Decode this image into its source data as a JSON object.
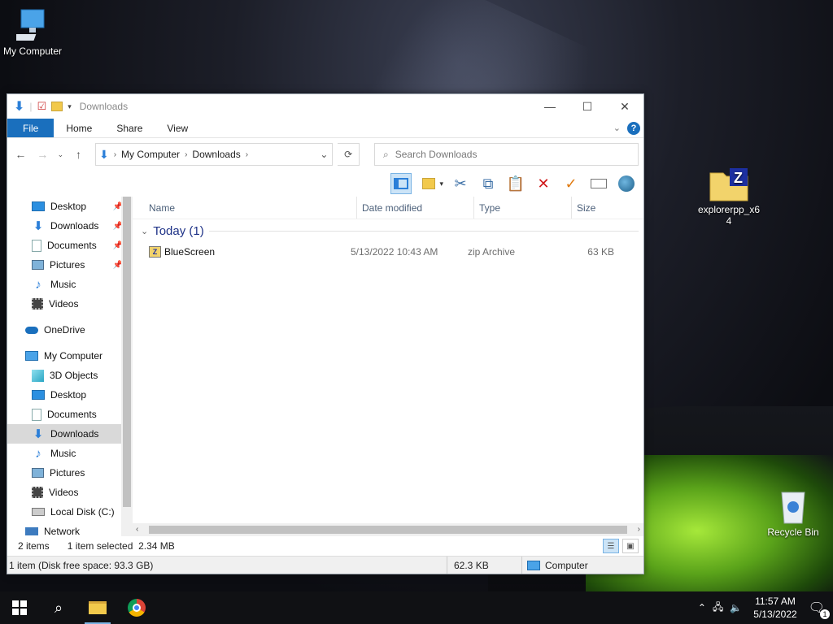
{
  "desktop": {
    "icons": [
      {
        "label": "My Computer"
      },
      {
        "label": "explorerpp_x64"
      },
      {
        "label": "Recycle Bin"
      }
    ]
  },
  "window": {
    "title": "Downloads",
    "ribbon_tabs": [
      "File",
      "Home",
      "Share",
      "View"
    ],
    "address": {
      "segments": [
        "My Computer",
        "Downloads"
      ]
    },
    "search": {
      "placeholder": "Search Downloads"
    },
    "nav": {
      "quick_access": [
        {
          "label": "Desktop",
          "icon": "desktop-icon",
          "pinned": true
        },
        {
          "label": "Downloads",
          "icon": "download-icon",
          "pinned": true
        },
        {
          "label": "Documents",
          "icon": "document-icon",
          "pinned": true
        },
        {
          "label": "Pictures",
          "icon": "picture-icon",
          "pinned": true
        },
        {
          "label": "Music",
          "icon": "music-icon",
          "pinned": false
        },
        {
          "label": "Videos",
          "icon": "video-icon",
          "pinned": false
        }
      ],
      "onedrive": "OneDrive",
      "computer": "My Computer",
      "computer_items": [
        {
          "label": "3D Objects",
          "icon": "cube-icon"
        },
        {
          "label": "Desktop",
          "icon": "desktop-icon"
        },
        {
          "label": "Documents",
          "icon": "document-icon"
        },
        {
          "label": "Downloads",
          "icon": "download-icon",
          "selected": true
        },
        {
          "label": "Music",
          "icon": "music-icon"
        },
        {
          "label": "Pictures",
          "icon": "picture-icon"
        },
        {
          "label": "Videos",
          "icon": "video-icon"
        },
        {
          "label": "Local Disk (C:)",
          "icon": "drive-icon"
        }
      ],
      "network": "Network"
    },
    "columns": {
      "name": "Name",
      "date": "Date modified",
      "type": "Type",
      "size": "Size"
    },
    "group": "Today (1)",
    "files": [
      {
        "name": "BlueScreen",
        "date": "5/13/2022 10:43 AM",
        "type": "zip Archive",
        "size": "63 KB"
      }
    ],
    "status": {
      "items": "2 items",
      "selected": "1 item selected  2.34 MB",
      "free_space": "1 item (Disk free space: 93.3 GB)",
      "size": "62.3 KB",
      "location": "Computer"
    }
  },
  "taskbar": {
    "time": "11:57 AM",
    "date": "5/13/2022",
    "notification_count": "1"
  },
  "colors": {
    "accent": "#1a6fbd",
    "folder": "#f2c94c",
    "group_header": "#1e3287"
  }
}
